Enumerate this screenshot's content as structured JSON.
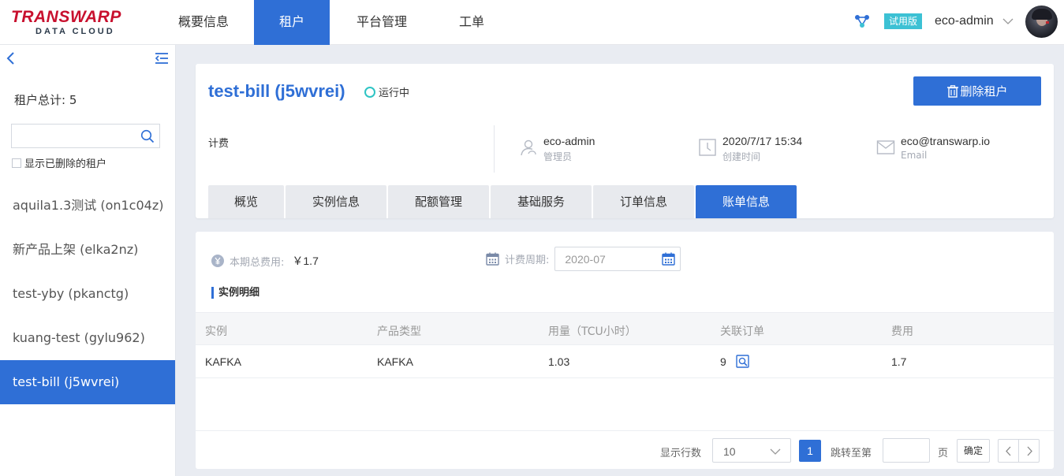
{
  "header": {
    "logo_text": "TRANSWARP",
    "logo_sub": "DATA CLOUD",
    "nav": [
      "概要信息",
      "租户",
      "平台管理",
      "工单"
    ],
    "trial_badge": "试用版",
    "user": "eco-admin"
  },
  "sidebar": {
    "total_label": "租户总计: 5",
    "search_placeholder": "",
    "show_deleted_label": "显示已删除的租户",
    "tenants": [
      {
        "label": "aquila1.3测试 (on1c04z)"
      },
      {
        "label": "新产品上架 (elka2nz)"
      },
      {
        "label": "test-yby (pkanctg)"
      },
      {
        "label": "kuang-test (gylu962)"
      },
      {
        "label": "test-bill (j5wvrei)"
      }
    ]
  },
  "tenant": {
    "title": "test-bill (j5wvrei)",
    "status": "运行中",
    "delete_button": "删除租户",
    "billing_label": "计费",
    "admin": {
      "value": "eco-admin",
      "label": "管理员"
    },
    "created": {
      "value": "2020/7/17 15:34",
      "label": "创建时间"
    },
    "email": {
      "value": "eco@transwarp.io",
      "label": "Email"
    },
    "tabs": [
      "概览",
      "实例信息",
      "配额管理",
      "基础服务",
      "订单信息",
      "账单信息"
    ]
  },
  "bill": {
    "total_label": "本期总费用:",
    "total_value": "￥1.7",
    "period_label": "计费周期:",
    "period_value": "2020-07",
    "section_title": "实例明细",
    "columns": [
      "实例",
      "产品类型",
      "用量（TCU小时）",
      "关联订单",
      "费用"
    ],
    "rows": [
      {
        "instance": "KAFKA",
        "product": "KAFKA",
        "usage": "1.03",
        "order": "9",
        "cost": "1.7"
      }
    ]
  },
  "pager": {
    "rows_label": "显示行数",
    "rows_value": "10",
    "current_page": "1",
    "jump_label": "跳转至第",
    "page_unit": "页",
    "ok_label": "确定"
  },
  "colors": {
    "accent": "#2f6fd6",
    "status": "#2ec4c4",
    "brand": "#c8102e",
    "badge": "#3cc1d4"
  }
}
